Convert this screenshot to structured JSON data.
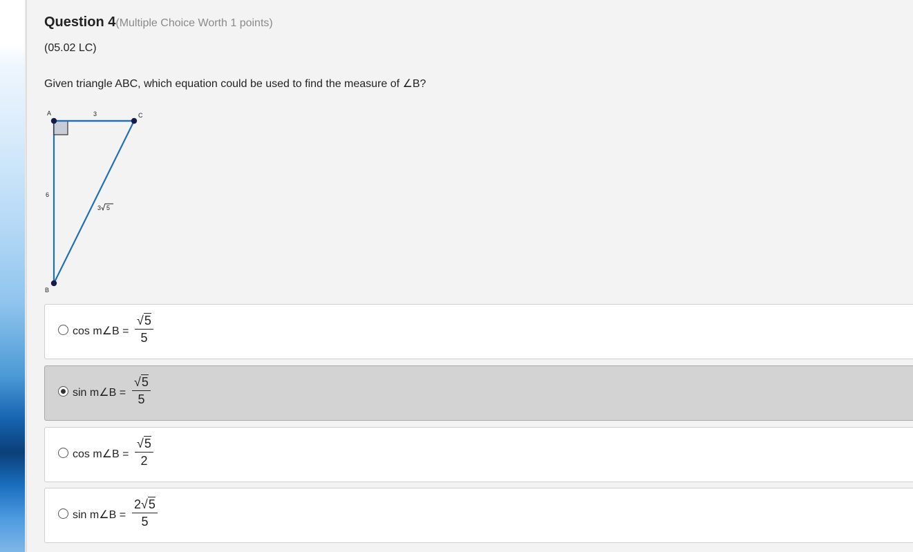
{
  "question": {
    "title": "Question 4",
    "worth": "(Multiple Choice Worth 1 points)",
    "code": "(05.02 LC)",
    "prompt": "Given triangle ABC, which equation could be used to find the measure of ∠B?"
  },
  "figure": {
    "vertex_a": "A",
    "vertex_b": "B",
    "vertex_c": "C",
    "side_ac": "3",
    "side_ab": "6",
    "side_bc_coef": "3",
    "side_bc_rad": "5",
    "line_color": "#1f6fb8",
    "point_color": "#1a1a4a"
  },
  "options": [
    {
      "label": "cos m∠B =",
      "num_coef": "",
      "num_rad": "5",
      "den": "5",
      "selected": false
    },
    {
      "label": "sin m∠B =",
      "num_coef": "",
      "num_rad": "5",
      "den": "5",
      "selected": true
    },
    {
      "label": "cos m∠B =",
      "num_coef": "",
      "num_rad": "5",
      "den": "2",
      "selected": false
    },
    {
      "label": "sin m∠B =",
      "num_coef": "2",
      "num_rad": "5",
      "den": "5",
      "selected": false
    }
  ]
}
